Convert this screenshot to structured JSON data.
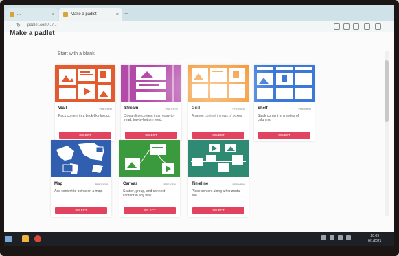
{
  "browser": {
    "tabs": [
      {
        "label": "...",
        "active": false
      },
      {
        "label": "Make a padlet",
        "active": true
      }
    ],
    "new_tab": "+",
    "url": "padlet.com/.../..."
  },
  "page": {
    "title": "Make a padlet",
    "heading": "Start with a blank"
  },
  "cards": [
    {
      "title": "Wall",
      "preview": "PREVIEW",
      "desc": "Pack content in a brick-like layout.",
      "button": "SELECT"
    },
    {
      "title": "Stream",
      "preview": "PREVIEW",
      "desc": "Streamline content in an easy-to-read, top-to-bottom feed.",
      "button": "SELECT"
    },
    {
      "title": "Grid",
      "preview": "PREVIEW",
      "desc": "Arrange content in rows of boxes.",
      "button": "SELECT"
    },
    {
      "title": "Shelf",
      "preview": "PREVIEW",
      "desc": "Stack content in a series of columns.",
      "button": "SELECT"
    },
    {
      "title": "Map",
      "preview": "PREVIEW",
      "desc": "Add content to points on a map.",
      "button": "SELECT"
    },
    {
      "title": "Canvas",
      "preview": "PREVIEW",
      "desc": "Scatter, group, and connect content in any way.",
      "button": "SELECT"
    },
    {
      "title": "Timeline",
      "preview": "PREVIEW",
      "desc": "Place content along a horizontal line.",
      "button": "SELECT"
    }
  ],
  "colors": {
    "wall": "#e25a2e",
    "stream": "#b44aa8",
    "grid": "#f28d1f",
    "shelf": "#3b78d8",
    "map": "#2f5fae",
    "canvas": "#3a9a3d",
    "timeline": "#2f8a73",
    "button": "#e2445f"
  },
  "taskbar": {
    "time": "20:09",
    "date": "6/1/2021"
  }
}
